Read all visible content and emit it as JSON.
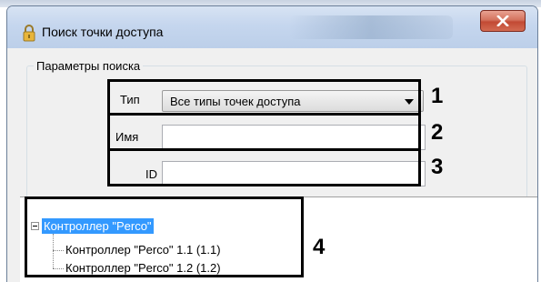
{
  "window": {
    "title": "Поиск точки доступа",
    "close_icon": "close-icon",
    "lock_icon": "lock-icon"
  },
  "search_params": {
    "legend": "Параметры поиска",
    "type_label": "Тип",
    "type_value": "Все типы точек доступа",
    "name_label": "Имя",
    "name_value": "",
    "id_label": "ID",
    "id_value": ""
  },
  "tree": {
    "root_label": "Контроллер \"Perco\"",
    "children": [
      "Контроллер \"Perco\" 1.1 (1.1)",
      "Контроллер \"Perco\" 1.2 (1.2)"
    ]
  },
  "callouts": [
    "1",
    "2",
    "3",
    "4"
  ],
  "colors": {
    "selection": "#3399ff",
    "close_button": "#c24a34",
    "highlight": "#000000"
  }
}
